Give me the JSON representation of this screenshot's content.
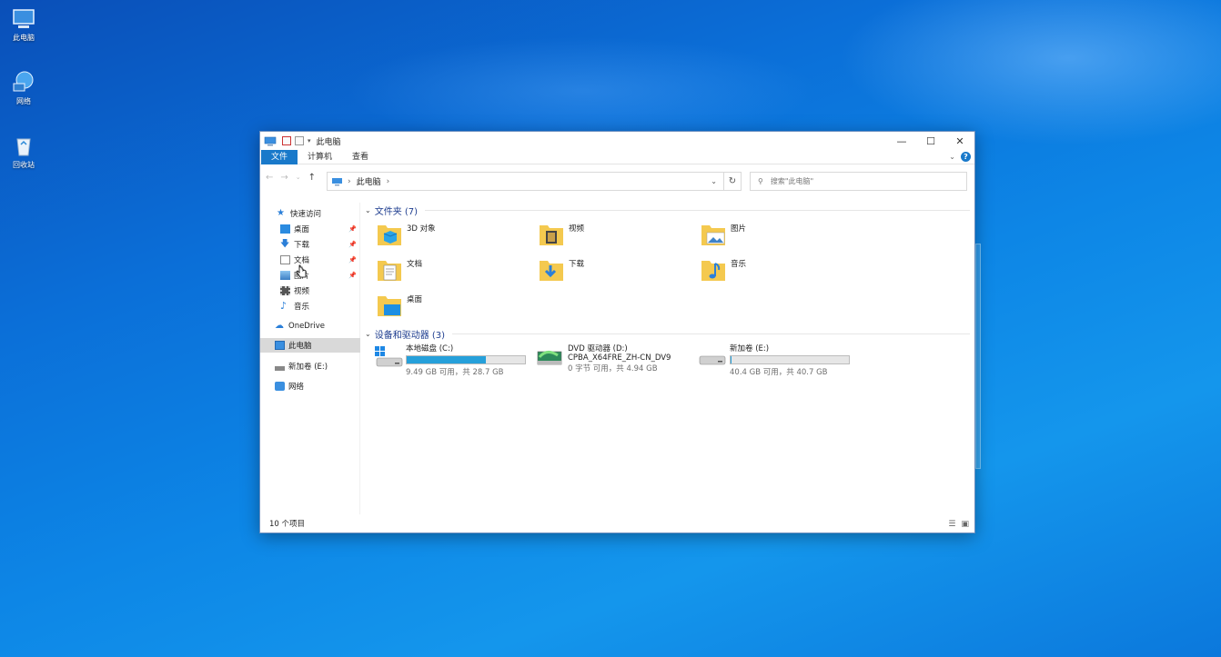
{
  "desktop": {
    "icons": [
      {
        "label": "此电脑",
        "icon": "computer-icon"
      },
      {
        "label": "网络",
        "icon": "network-icon"
      },
      {
        "label": "回收站",
        "icon": "recycle-bin-icon"
      }
    ]
  },
  "window": {
    "title": "此电脑",
    "controls": {
      "minimize": "—",
      "maximize": "☐",
      "close": "✕"
    },
    "ribbon_tabs": [
      "文件",
      "计算机",
      "查看"
    ],
    "address": {
      "crumb": "此电脑",
      "separator": "›"
    },
    "search_placeholder": "搜索\"此电脑\"",
    "nav": {
      "quick_access": "快速访问",
      "items": [
        "桌面",
        "下载",
        "文档",
        "图片",
        "视频",
        "音乐"
      ],
      "onedrive": "OneDrive",
      "this_pc": "此电脑",
      "new_volume": "新加卷 (E:)",
      "network": "网络"
    },
    "folders_header": "文件夹 (7)",
    "folders": [
      "3D 对象",
      "视频",
      "图片",
      "文档",
      "下载",
      "音乐",
      "桌面"
    ],
    "devices_header": "设备和驱动器 (3)",
    "drives": [
      {
        "name": "本地磁盘 (C:)",
        "sub": "9.49 GB 可用，共 28.7 GB",
        "used_fraction": 0.67,
        "icon": "windows-drive-icon"
      },
      {
        "name": "DVD 驱动器 (D:)",
        "name2": "CPBA_X64FRE_ZH-CN_DV9",
        "sub": "0 字节 可用，共 4.94 GB",
        "icon": "dvd-drive-icon"
      },
      {
        "name": "新加卷 (E:)",
        "sub": "40.4 GB 可用，共 40.7 GB",
        "used_fraction": 0.01,
        "icon": "hard-drive-icon"
      }
    ],
    "status_count": "10 个项目"
  },
  "colors": {
    "accent": "#1979ca",
    "drive_bar": "#26a0da",
    "folder": "#f4c94f"
  }
}
